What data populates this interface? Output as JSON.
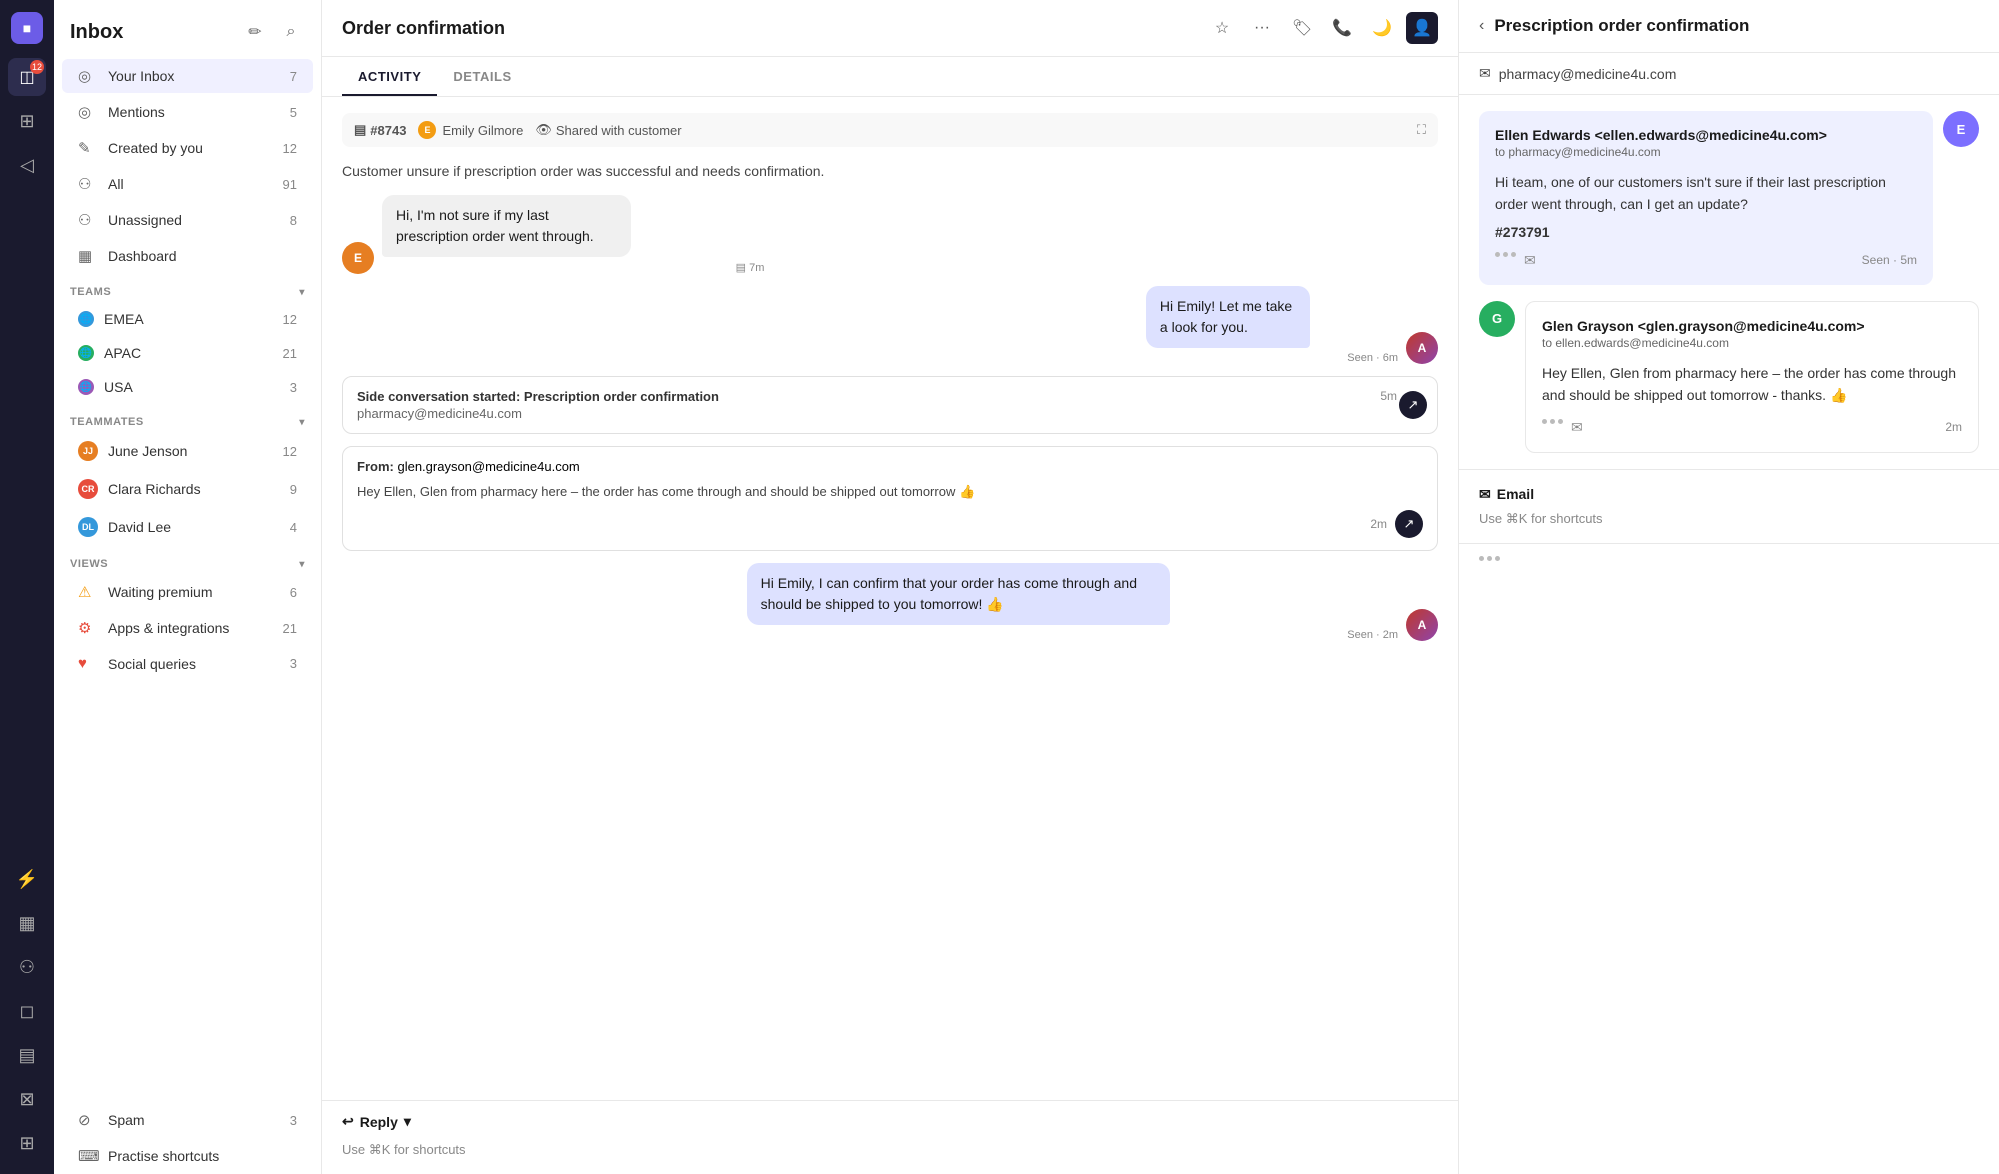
{
  "iconbar": {
    "logo": "■",
    "badge_count": "12",
    "items": [
      {
        "name": "inbox-icon",
        "icon": "◫",
        "active": true
      },
      {
        "name": "layers-icon",
        "icon": "⊞",
        "active": false
      },
      {
        "name": "send-icon",
        "icon": "◁",
        "active": false
      },
      {
        "name": "lightning-icon",
        "icon": "⚡",
        "active": false
      },
      {
        "name": "chart-icon",
        "icon": "▦",
        "active": false
      },
      {
        "name": "people-icon",
        "icon": "⚇",
        "active": false
      },
      {
        "name": "chat-icon",
        "icon": "◻",
        "active": false
      },
      {
        "name": "book-icon",
        "icon": "▤",
        "active": false
      },
      {
        "name": "cart-icon",
        "icon": "⊠",
        "active": false
      },
      {
        "name": "grid-icon",
        "icon": "⊞",
        "active": false
      }
    ]
  },
  "sidebar": {
    "title": "Inbox",
    "compose_label": "Compose",
    "search_label": "Search",
    "nav_items": [
      {
        "label": "Your Inbox",
        "icon": "◎",
        "count": "7",
        "active": true
      },
      {
        "label": "Mentions",
        "icon": "◎",
        "count": "5",
        "active": false
      },
      {
        "label": "Created by you",
        "icon": "✎",
        "count": "12",
        "active": false
      },
      {
        "label": "All",
        "icon": "⚇",
        "count": "91",
        "active": false
      },
      {
        "label": "Unassigned",
        "icon": "⚇",
        "count": "8",
        "active": false
      },
      {
        "label": "Dashboard",
        "icon": "▦",
        "count": "",
        "active": false
      }
    ],
    "teams_section": "TEAMS",
    "teams": [
      {
        "label": "EMEA",
        "color": "#3498db",
        "count": "12"
      },
      {
        "label": "APAC",
        "color": "#27ae60",
        "count": "21"
      },
      {
        "label": "USA",
        "color": "#9b59b6",
        "count": "3"
      }
    ],
    "teammates_section": "TEAMMATES",
    "teammates": [
      {
        "label": "June Jenson",
        "color": "#e67e22",
        "count": "12",
        "initials": "JJ"
      },
      {
        "label": "Clara Richards",
        "color": "#e74c3c",
        "count": "9",
        "initials": "CR"
      },
      {
        "label": "David Lee",
        "color": "#3498db",
        "count": "4",
        "initials": "DL"
      }
    ],
    "views_section": "VIEWS",
    "views": [
      {
        "label": "Waiting premium",
        "icon": "⚠",
        "icon_color": "#f39c12",
        "count": "6"
      },
      {
        "label": "Apps & integrations",
        "icon": "⚙",
        "icon_color": "#e74c3c",
        "count": "21"
      },
      {
        "label": "Social queries",
        "icon": "♥",
        "icon_color": "#e74c3c",
        "count": "3"
      }
    ],
    "spam_label": "Spam",
    "spam_count": "3",
    "shortcuts_label": "Practise shortcuts"
  },
  "main": {
    "title": "Order confirmation",
    "tabs": [
      {
        "label": "ACTIVITY",
        "active": true
      },
      {
        "label": "DETAILS",
        "active": false
      }
    ],
    "ticket_id": "#8743",
    "assignee": "Emily Gilmore",
    "shared_label": "Shared with customer",
    "description": "Customer unsure if prescription order was successful and needs confirmation.",
    "messages": [
      {
        "id": "msg1",
        "type": "incoming",
        "text": "Hi, I'm not sure if my last prescription order went through.",
        "time": "7m",
        "initials": "E",
        "avatar_color": "#e67e22"
      },
      {
        "id": "msg2",
        "type": "outgoing",
        "text": "Hi Emily! Let me take a look for you.",
        "time": "Seen · 6m",
        "avatar_url": "agent1"
      }
    ],
    "side_conv": {
      "label": "Side conversation started:",
      "title": "Prescription order confirmation",
      "email": "pharmacy@medicine4u.com",
      "time": "5m"
    },
    "forwarded_email": {
      "from_label": "From:",
      "from_email": "glen.grayson@medicine4u.com",
      "body": "Hey Ellen, Glen from pharmacy here – the order has come through and should be shipped out tomorrow 👍",
      "time": "2m"
    },
    "confirm_message": {
      "type": "outgoing",
      "text": "Hi Emily, I can confirm that your order has come through and should be shipped to you tomorrow! 👍",
      "time": "Seen · 2m"
    },
    "reply_label": "Reply",
    "reply_placeholder": "Use ⌘K for shortcuts"
  },
  "rightpanel": {
    "title": "Prescription order confirmation",
    "email": "pharmacy@medicine4u.com",
    "emails": [
      {
        "id": "email1",
        "from": "Ellen Edwards <ellen.edwards@medicine4u.com>",
        "to": "pharmacy@medicine4u.com",
        "body": "Hi team, one of our customers isn't sure if their last prescription order went through, can I get an update?",
        "ref": "#273791",
        "time": "Seen · 5m",
        "avatar_initials": "E",
        "avatar_color": "#7c6fff"
      },
      {
        "id": "email2",
        "from": "Glen Grayson <glen.grayson@medicine4u.com>",
        "to": "ellen.edwards@medicine4u.com",
        "body": "Hey Ellen, Glen from pharmacy here – the order has come through and should be shipped out tomorrow - thanks. 👍",
        "time": "2m",
        "avatar_initials": "G",
        "avatar_color": "#27ae60"
      }
    ],
    "reply_section": {
      "label": "Email",
      "placeholder": "Use ⌘K for shortcuts"
    }
  }
}
